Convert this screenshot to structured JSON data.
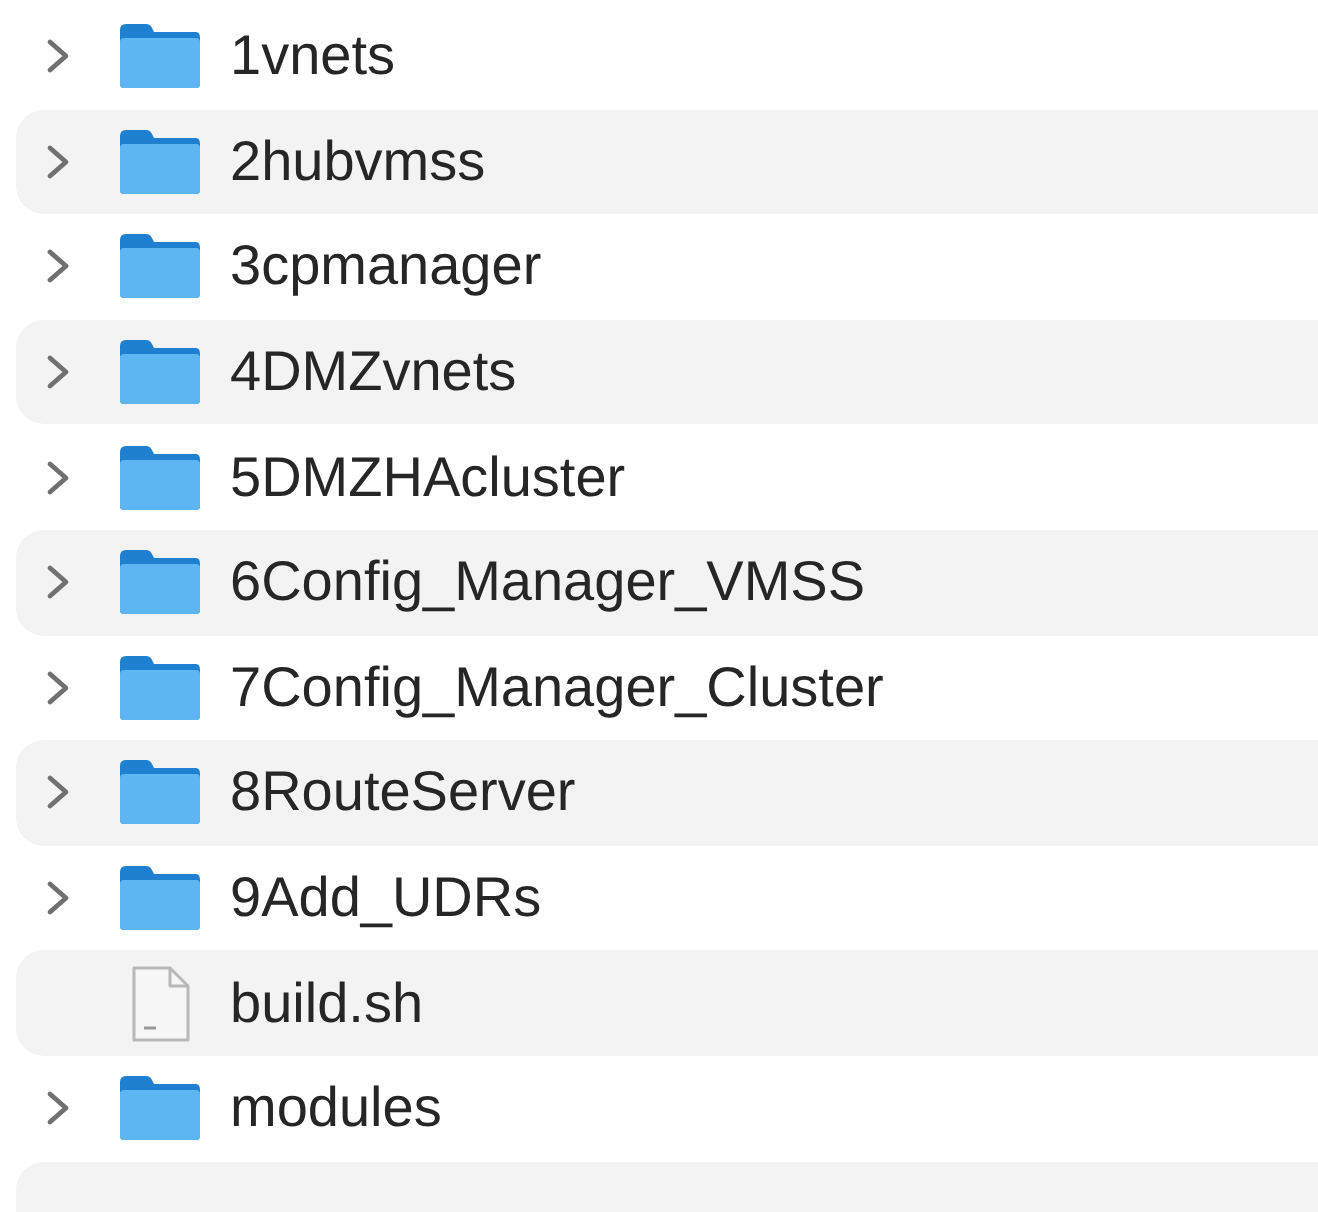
{
  "items": [
    {
      "name": "1vnets",
      "kind": "folder",
      "expanded": false
    },
    {
      "name": "2hubvmss",
      "kind": "folder",
      "expanded": false
    },
    {
      "name": "3cpmanager",
      "kind": "folder",
      "expanded": false
    },
    {
      "name": "4DMZvnets",
      "kind": "folder",
      "expanded": false
    },
    {
      "name": "5DMZHAcluster",
      "kind": "folder",
      "expanded": false
    },
    {
      "name": "6Config_Manager_VMSS",
      "kind": "folder",
      "expanded": false
    },
    {
      "name": "7Config_Manager_Cluster",
      "kind": "folder",
      "expanded": false
    },
    {
      "name": "8RouteServer",
      "kind": "folder",
      "expanded": false
    },
    {
      "name": "9Add_UDRs",
      "kind": "folder",
      "expanded": false
    },
    {
      "name": "build.sh",
      "kind": "file"
    },
    {
      "name": "modules",
      "kind": "folder",
      "expanded": false
    }
  ]
}
